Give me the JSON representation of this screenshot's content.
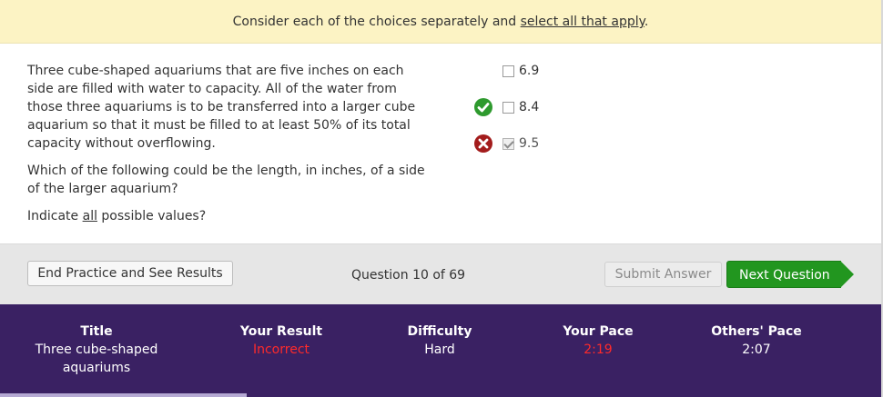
{
  "banner": {
    "prefix": "Consider each of the choices separately and ",
    "link": "select all that apply",
    "suffix": "."
  },
  "question": {
    "stem": "Three cube-shaped aquariums that are five inches on each side are filled with water to capacity. All of the water from those three aquariums is to be transferred into a larger cube aquarium so that it must be filled to at least 50% of its total capacity without overflowing.",
    "ask": "Which of the following could be the length, in inches, of a side of the larger aquarium?",
    "indicate_prefix": "Indicate ",
    "indicate_underlined": "all",
    "indicate_suffix": " possible values?"
  },
  "choices": [
    {
      "label": "6.9",
      "checked": false,
      "feedback": "none"
    },
    {
      "label": "8.4",
      "checked": false,
      "feedback": "correct"
    },
    {
      "label": "9.5",
      "checked": true,
      "feedback": "incorrect"
    }
  ],
  "toolbar": {
    "end_label": "End Practice and See Results",
    "question_counter": "Question 10 of 69",
    "submit_label": "Submit Answer",
    "next_label": "Next Question"
  },
  "results": {
    "title_header": "Title",
    "title_value": "Three cube-shaped aquariums",
    "result_header": "Your Result",
    "result_value": "Incorrect",
    "difficulty_header": "Difficulty",
    "difficulty_value": "Hard",
    "pace_header": "Your Pace",
    "pace_value": "2:19",
    "others_header": "Others' Pace",
    "others_value": "2:07"
  },
  "progress": {
    "fraction": 0.28
  },
  "colors": {
    "banner_bg": "#fcf3c4",
    "results_bg": "#3a2163",
    "next_button": "#22961f",
    "correct_icon": "#2e9a2e",
    "incorrect_icon": "#a31c1c",
    "incorrect_text": "#ff2a2a"
  }
}
